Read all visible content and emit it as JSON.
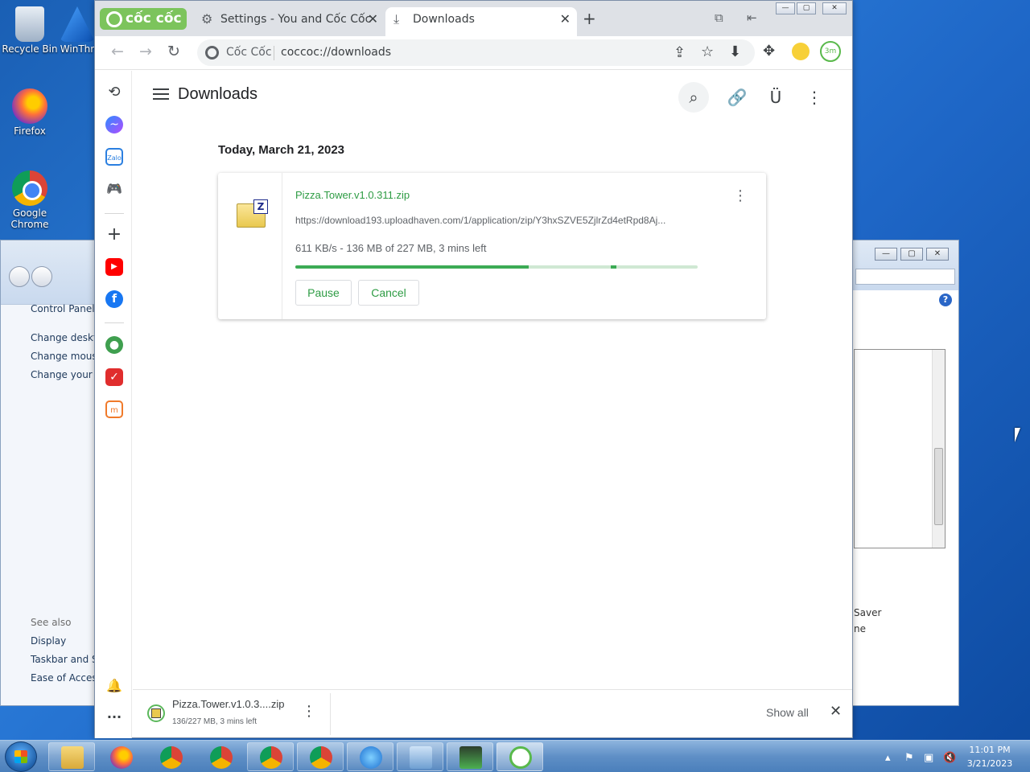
{
  "desktop": {
    "icons": [
      {
        "label": "Recycle Bin"
      },
      {
        "label": "WinThr"
      },
      {
        "label": "Firefox"
      },
      {
        "label": "Google Chrome"
      }
    ]
  },
  "control_panel": {
    "links": [
      "Control Panel H",
      "Change deskto",
      "Change mouse",
      "Change your a"
    ],
    "see_also_label": "See also",
    "see_also": [
      "Display",
      "Taskbar and St",
      "Ease of Access"
    ],
    "right_fragments": [
      "Saver",
      "ne"
    ],
    "help_glyph": "?"
  },
  "browser": {
    "brand": "cốc cốc",
    "tabs": [
      {
        "label": "Settings - You and Cốc Cốc",
        "icon": "gear-icon",
        "close": "✕"
      },
      {
        "label": "Downloads",
        "icon": "download-icon",
        "close": "✕"
      }
    ],
    "new_tab": "+",
    "omnibox": {
      "site_chip": "Cốc Cốc",
      "url": "coccoc://downloads"
    },
    "timer_label": "3m"
  },
  "downloads_page": {
    "title": "Downloads",
    "date_header": "Today, March 21, 2023",
    "item": {
      "filename": "Pizza.Tower.v1.0.311.zip",
      "url": "https://download193.uploadhaven.com/1/application/zip/Y3hxSZVE5ZjlrZd4etRpd8Aj...",
      "status": "611 KB/s  -  136 MB of 227 MB, 3 mins left",
      "progress": 0.58,
      "pause_label": "Pause",
      "cancel_label": "Cancel"
    }
  },
  "shelf": {
    "filename": "Pizza.Tower.v1.0.3....zip",
    "substatus": "136/227 MB, 3 mins left",
    "show_all": "Show all"
  },
  "taskbar": {
    "time": "11:01 PM",
    "date": "3/21/2023"
  },
  "colors": {
    "accent_green": "#2e9c44",
    "progress_green": "#3cab55",
    "brand_green": "#7cc45c"
  }
}
